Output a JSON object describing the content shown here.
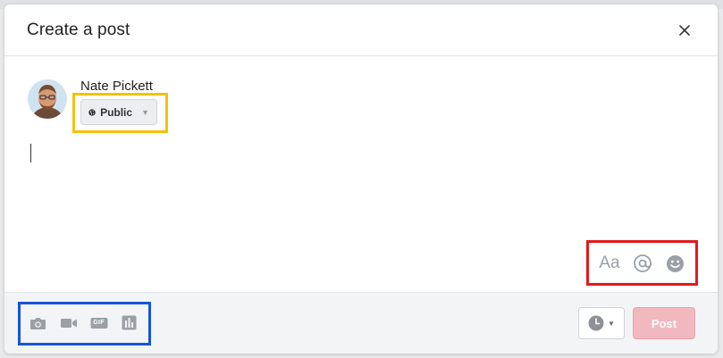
{
  "dialog": {
    "title": "Create a post",
    "close_icon": "close-icon"
  },
  "author": {
    "name": "Nate Pickett",
    "avatar": "user-avatar"
  },
  "privacy": {
    "selected": "Public",
    "icon": "globe-icon",
    "caret_icon": "caret-down-icon"
  },
  "composer": {
    "value": ""
  },
  "format_tools": {
    "text_format_label": "Aa",
    "mention_icon": "at-icon",
    "emoji_icon": "smiley-icon"
  },
  "media_tools": [
    {
      "name": "photo",
      "icon": "camera-icon"
    },
    {
      "name": "video",
      "icon": "video-camera-icon"
    },
    {
      "name": "gif",
      "icon": "gif-icon",
      "label": "GIF"
    },
    {
      "name": "poll",
      "icon": "bar-chart-icon"
    }
  ],
  "footer": {
    "schedule_icon": "clock-icon",
    "post_label": "Post"
  },
  "colors": {
    "privacy_highlight": "#f4c20d",
    "format_highlight": "#e11b1b",
    "media_highlight": "#1455d9",
    "post_button_disabled": "#f2b8c0"
  }
}
